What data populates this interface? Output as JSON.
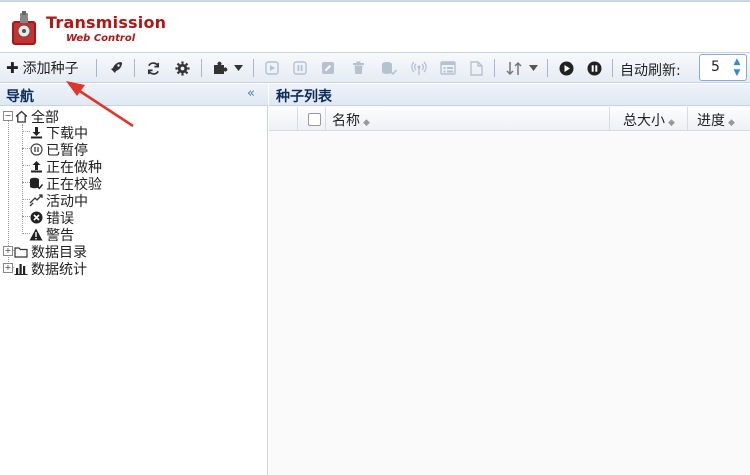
{
  "app": {
    "title": "Transmission",
    "subtitle": "Web Control"
  },
  "toolbar": {
    "add_label": "添加种子",
    "auto_refresh_label": "自动刷新:",
    "auto_refresh_value": "5"
  },
  "nav": {
    "title": "导航",
    "collapse_glyph": "«",
    "root_label": "全部",
    "items": [
      {
        "label": "下载中",
        "icon": "download-icon"
      },
      {
        "label": "已暂停",
        "icon": "pause-circle-icon"
      },
      {
        "label": "正在做种",
        "icon": "upload-icon"
      },
      {
        "label": "正在校验",
        "icon": "database-check-icon"
      },
      {
        "label": "活动中",
        "icon": "exchange-icon"
      },
      {
        "label": "错误",
        "icon": "error-circle-icon"
      },
      {
        "label": "警告",
        "icon": "warning-icon"
      }
    ],
    "groups": [
      {
        "label": "数据目录",
        "icon": "folder-icon"
      },
      {
        "label": "数据统计",
        "icon": "bar-chart-icon"
      }
    ]
  },
  "list": {
    "title": "种子列表",
    "columns": {
      "name": "名称",
      "size": "总大小",
      "progress": "进度"
    }
  },
  "colors": {
    "accent": "#b01818",
    "header_text": "#0e2d5e",
    "annotation_arrow": "#e0352b"
  }
}
